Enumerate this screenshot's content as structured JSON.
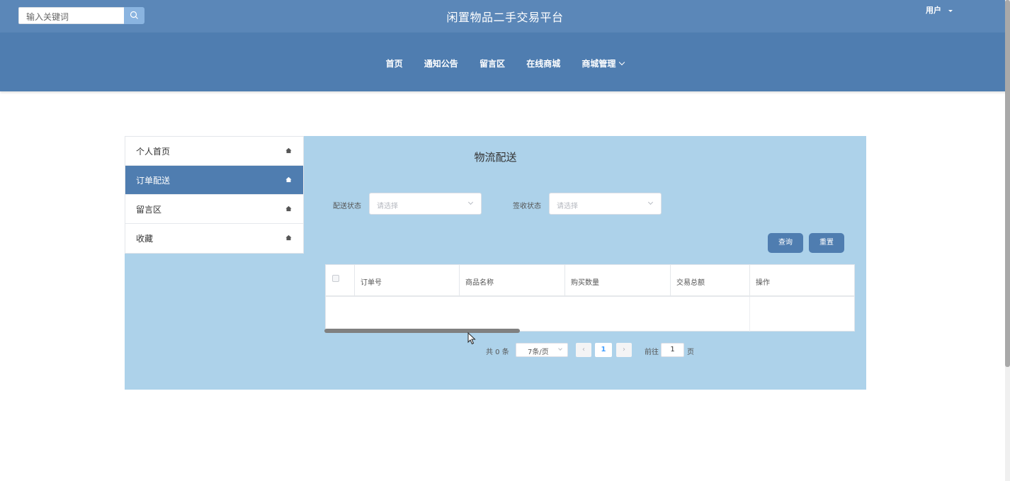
{
  "header": {
    "search_placeholder": "输入关键词",
    "site_title": "闲置物品二手交易平台",
    "user_label": "用户"
  },
  "nav": {
    "items": [
      "首页",
      "通知公告",
      "留言区",
      "在线商城",
      "商城管理"
    ]
  },
  "sidebar": {
    "items": [
      {
        "label": "个人首页",
        "active": false
      },
      {
        "label": "订单配送",
        "active": true
      },
      {
        "label": "留言区",
        "active": false
      },
      {
        "label": "收藏",
        "active": false
      }
    ]
  },
  "main": {
    "title": "物流配送",
    "filters": [
      {
        "label": "配送状态",
        "placeholder": "请选择"
      },
      {
        "label": "签收状态",
        "placeholder": "请选择"
      }
    ],
    "buttons": {
      "query": "查询",
      "reset": "重置"
    },
    "table": {
      "columns": [
        "订单号",
        "商品名称",
        "购买数量",
        "交易总额",
        "操作"
      ],
      "rows": []
    },
    "pagination": {
      "total": "共 0 条",
      "page_size": "7条/页",
      "current_page": "1",
      "goto_label": "前往",
      "goto_value": "1",
      "unit": "页"
    }
  },
  "colors": {
    "topbar": "#5b87b8",
    "navband": "#4f7db0",
    "panel": "#add2ea",
    "active": "#4f7db0"
  }
}
